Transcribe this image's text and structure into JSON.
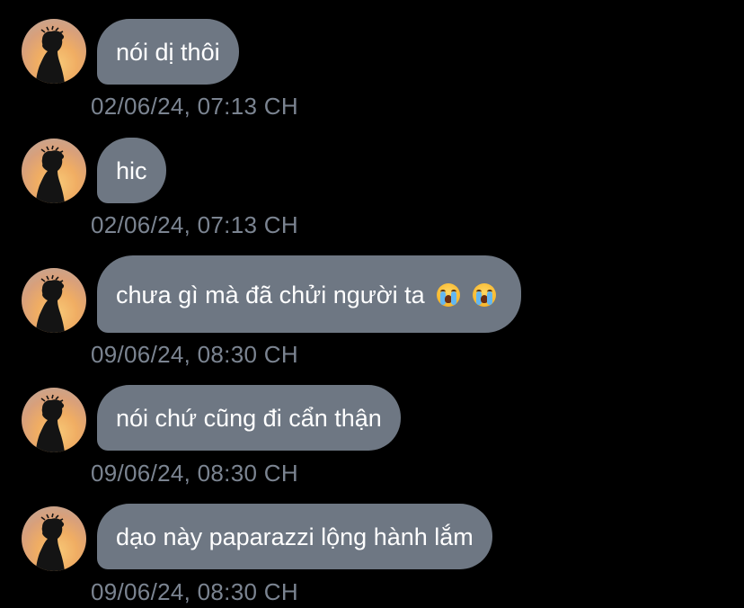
{
  "messages": [
    {
      "text": "nói dị thôi",
      "time": "02/06/24, 07:13 CH",
      "emojis": []
    },
    {
      "text": "hic",
      "time": "02/06/24, 07:13 CH",
      "emojis": []
    },
    {
      "text": "chưa gì mà đã chửi người ta",
      "time": "09/06/24, 08:30 CH",
      "emojis": [
        "loudly-crying-face-emoji",
        "loudly-crying-face-emoji"
      ]
    },
    {
      "text": "nói chứ cũng đi cẩn thận",
      "time": "09/06/24, 08:30 CH",
      "emojis": []
    },
    {
      "text": "dạo này paparazzi lộng hành lắm",
      "time": "09/06/24, 08:30 CH",
      "emojis": []
    }
  ],
  "colors": {
    "background": "#000000",
    "bubble": "#6e7783",
    "bubble_text": "#ffffff",
    "timestamp": "#7b8491"
  },
  "avatar": {
    "icon": "user-avatar-silhouette-sunset"
  }
}
